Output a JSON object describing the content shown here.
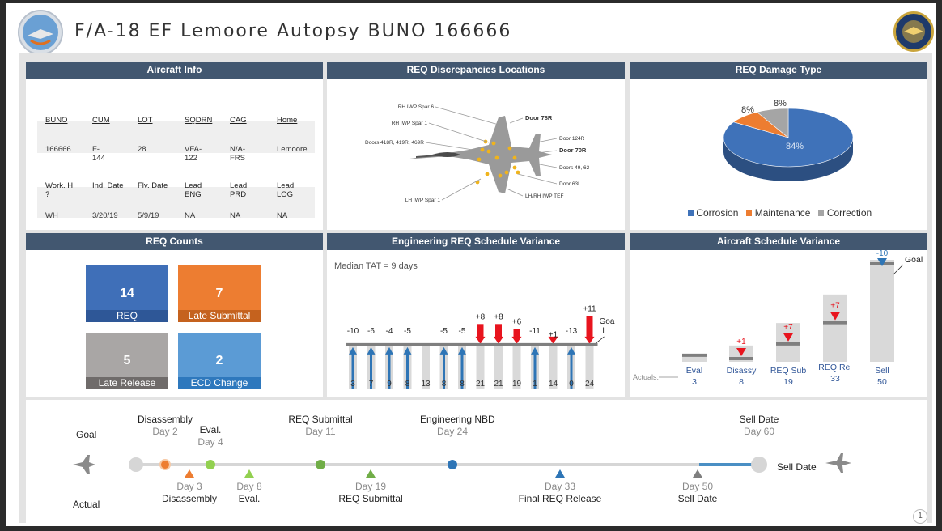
{
  "header": {
    "title": "F/A-18 EF Lemoore Autopsy BUNO 166666",
    "page_number": "1"
  },
  "aircraft_info": {
    "title": "Aircraft Info",
    "row1_headers": [
      "BUNO",
      "CUM",
      "LOT",
      "SQDRN",
      "CAG",
      "Home"
    ],
    "row1_values": [
      "166666",
      "F-144",
      "28",
      "VFA-122",
      "N/A-FRS",
      "Lemoore"
    ],
    "row2_headers": [
      "Work. H ?",
      "Ind. Date",
      "Flv. Date",
      "Lead ENG",
      "Lead PRD",
      "Lead LOG"
    ],
    "row2_values": [
      "WH",
      "3/20/19",
      "5/9/19",
      "NA",
      "NA",
      "NA"
    ]
  },
  "req_locations": {
    "title": "REQ Discrepancies Locations",
    "left_labels": [
      "RH IWP Spar 6",
      "RH IWP Spar 1",
      "Doors 418R, 419R, 469R",
      "LH IWP Spar 1"
    ],
    "right_labels": [
      "Door 78R",
      "Door 124R",
      "Door 70R",
      "Doors 49, 62",
      "Door 63L",
      "LH/RH IWP TEF"
    ]
  },
  "damage_type": {
    "title": "REQ Damage Type",
    "legend": [
      "Corrosion",
      "Maintenance",
      "Correction"
    ],
    "colors": [
      "#3f72b9",
      "#ed7d31",
      "#a5a5a5"
    ],
    "chart_data": {
      "type": "pie",
      "categories": [
        "Corrosion",
        "Maintenance",
        "Correction"
      ],
      "values": [
        84,
        8,
        8
      ],
      "labels": [
        "84%",
        "8%",
        "8%"
      ]
    }
  },
  "req_counts": {
    "title": "REQ Counts",
    "tiles": [
      {
        "value": "14",
        "label": "REQ",
        "color": "#3f6fb8",
        "band": "#2e5797"
      },
      {
        "value": "7",
        "label": "Late Submittal",
        "color": "#ed7d31",
        "band": "#c5621e"
      },
      {
        "value": "5",
        "label": "Late Release",
        "color": "#a9a6a5",
        "band": "#6f6b6a"
      },
      {
        "value": "2",
        "label": "ECD Change",
        "color": "#5b9bd5",
        "band": "#2e78bd"
      }
    ]
  },
  "eng_variance": {
    "title": "Engineering REQ Schedule Variance",
    "subtitle": "Median TAT = 9 days",
    "goal_label": "Goa l",
    "chart_data": {
      "type": "bar",
      "bar_values": [
        3,
        7,
        9,
        8,
        13,
        8,
        8,
        21,
        21,
        19,
        1,
        14,
        0,
        24
      ],
      "variance_labels": [
        "-10",
        "-6",
        "-4",
        "-5",
        "",
        "-5",
        "-5",
        "+8",
        "+8",
        "+6",
        "-11",
        "+1",
        "-13",
        "+11"
      ],
      "bottom_labels": [
        "3",
        "7",
        "9",
        "8",
        "13",
        "8",
        "8",
        "21",
        "21",
        "19",
        "1",
        "14",
        "0",
        "24"
      ],
      "goal": 13
    }
  },
  "aircraft_variance": {
    "title": "Aircraft Schedule Variance",
    "goal_label": "Goal",
    "actuals_label": "Actuals:",
    "chart_data": {
      "type": "bar",
      "categories": [
        "Eval",
        "Disassy",
        "REQ Sub",
        "REQ Rel",
        "Sell"
      ],
      "actuals": [
        3,
        8,
        19,
        33,
        50
      ],
      "variance_labels": [
        "",
        "+1",
        "+7",
        "+7",
        "-10"
      ],
      "goals": [
        4,
        2,
        11,
        24,
        60
      ]
    }
  },
  "timeline": {
    "goal_label": "Goal",
    "actual_label": "Actual",
    "sell_date_label": "Sell Date",
    "goal_events": [
      {
        "name": "Disassembly",
        "day": "Day 2"
      },
      {
        "name": "Eval.",
        "day": "Day 4"
      },
      {
        "name": "REQ Submittal",
        "day": "Day 11"
      },
      {
        "name": "Engineering NBD",
        "day": "Day 24"
      },
      {
        "name": "Sell Date",
        "day": "Day 60"
      }
    ],
    "actual_events": [
      {
        "name": "Disassembly",
        "day": "Day 3"
      },
      {
        "name": "Eval.",
        "day": "Day 8"
      },
      {
        "name": "REQ Submittal",
        "day": "Day 19"
      },
      {
        "name": "Final REQ Release",
        "day": "Day 33"
      },
      {
        "name": "Sell Date",
        "day": "Day 50"
      }
    ]
  }
}
